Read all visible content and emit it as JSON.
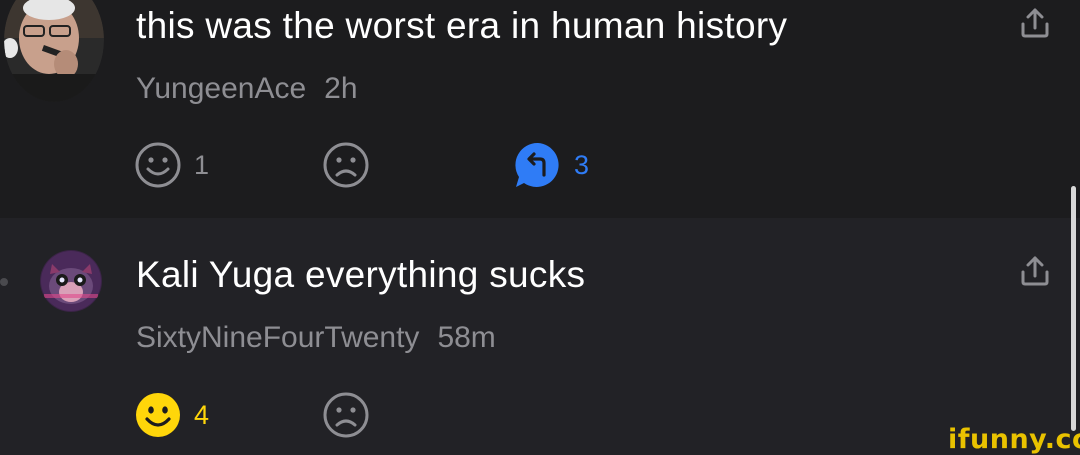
{
  "comments": [
    {
      "text": "this was the worst era in human history",
      "username": "YungeenAce",
      "time": "2h",
      "likes": "1",
      "replies": "3",
      "liked": false
    },
    {
      "text": "Kali Yuga everything sucks",
      "username": "SixtyNineFourTwenty",
      "time": "58m",
      "likes": "4",
      "liked": true
    }
  ],
  "icons": {
    "share": "share-icon",
    "smile": "smile-icon",
    "frown": "frown-icon",
    "reply": "reply-icon"
  },
  "colors": {
    "background": "#1c1c1e",
    "text": "#ffffff",
    "secondary": "#8e8e93",
    "reply_blue": "#2f7cf6",
    "liked_yellow": "#ffd60a",
    "watermark": "#e9c200"
  },
  "watermark": "ifunny.co"
}
